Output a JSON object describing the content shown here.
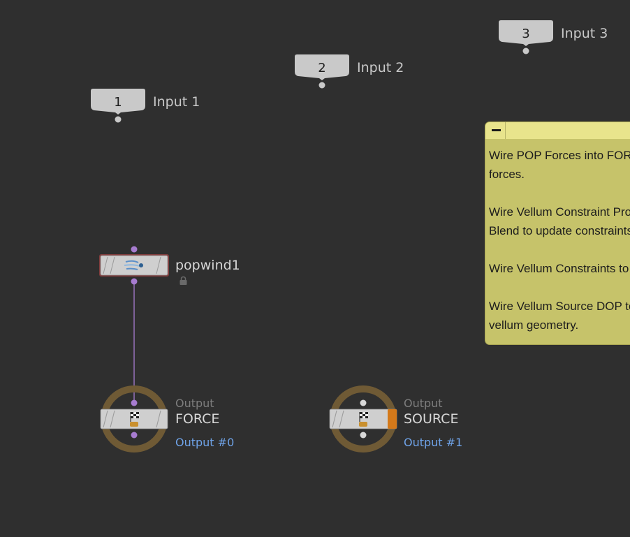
{
  "inputs": [
    {
      "number": "1",
      "label": "Input 1"
    },
    {
      "number": "2",
      "label": "Input 2"
    },
    {
      "number": "3",
      "label": "Input 3"
    }
  ],
  "nodes": {
    "popwind": {
      "name": "popwind1",
      "icon": "wind-icon",
      "locked": true,
      "lock_icon": "lock-icon"
    },
    "force_output": {
      "type": "Output",
      "name": "FORCE",
      "output": "Output #0",
      "icon": "checkered-flag-icon"
    },
    "source_output": {
      "type": "Output",
      "name": "SOURCE",
      "output": "Output #1",
      "icon": "checkered-flag-icon"
    }
  },
  "sticky_note": {
    "text": "Wire POP Forces into FORCE to apply\nforces.\n\nWire Vellum Constraint Property or\nBlend to update constraints.\n\nWire Vellum Constraints to add\n\nWire Vellum Source DOP to source\nvellum geometry."
  },
  "colors": {
    "background": "#2f2f2f",
    "node_body": "#cfcfcf",
    "wire": "#a77cd0",
    "output_ring": "#6f5a35",
    "sticky": "#c6c36a",
    "output_link": "#6fa3e8",
    "display_flag": "#d4791a"
  }
}
